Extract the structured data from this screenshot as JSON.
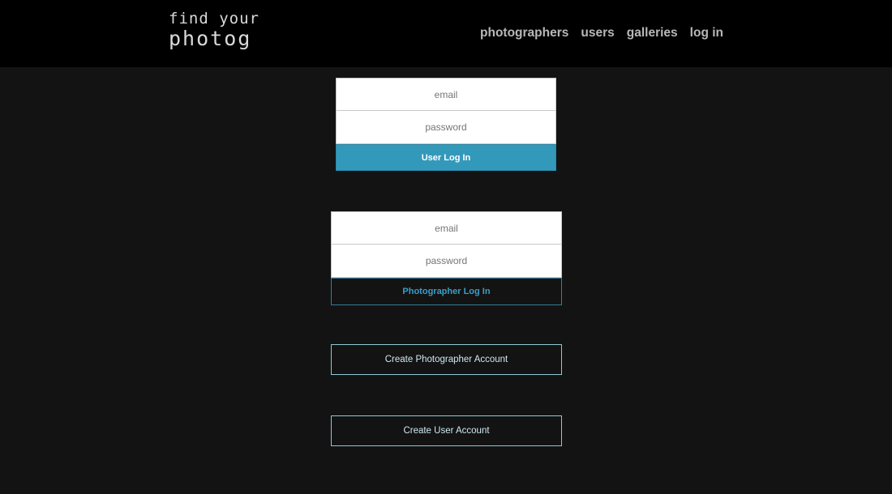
{
  "header": {
    "logo_line1": "find your",
    "logo_line2": "photog",
    "nav": [
      "photographers",
      "users",
      "galleries",
      "log in"
    ]
  },
  "user_login": {
    "email_placeholder": "email",
    "password_placeholder": "password",
    "button_label": "User Log In"
  },
  "photographer_login": {
    "email_placeholder": "email",
    "password_placeholder": "password",
    "button_label": "Photographer Log In"
  },
  "actions": {
    "create_photographer_label": "Create Photographer Account",
    "create_user_label": "Create User Account"
  },
  "colors": {
    "background": "#131313",
    "header": "#000000",
    "accent": "#3399bb"
  }
}
